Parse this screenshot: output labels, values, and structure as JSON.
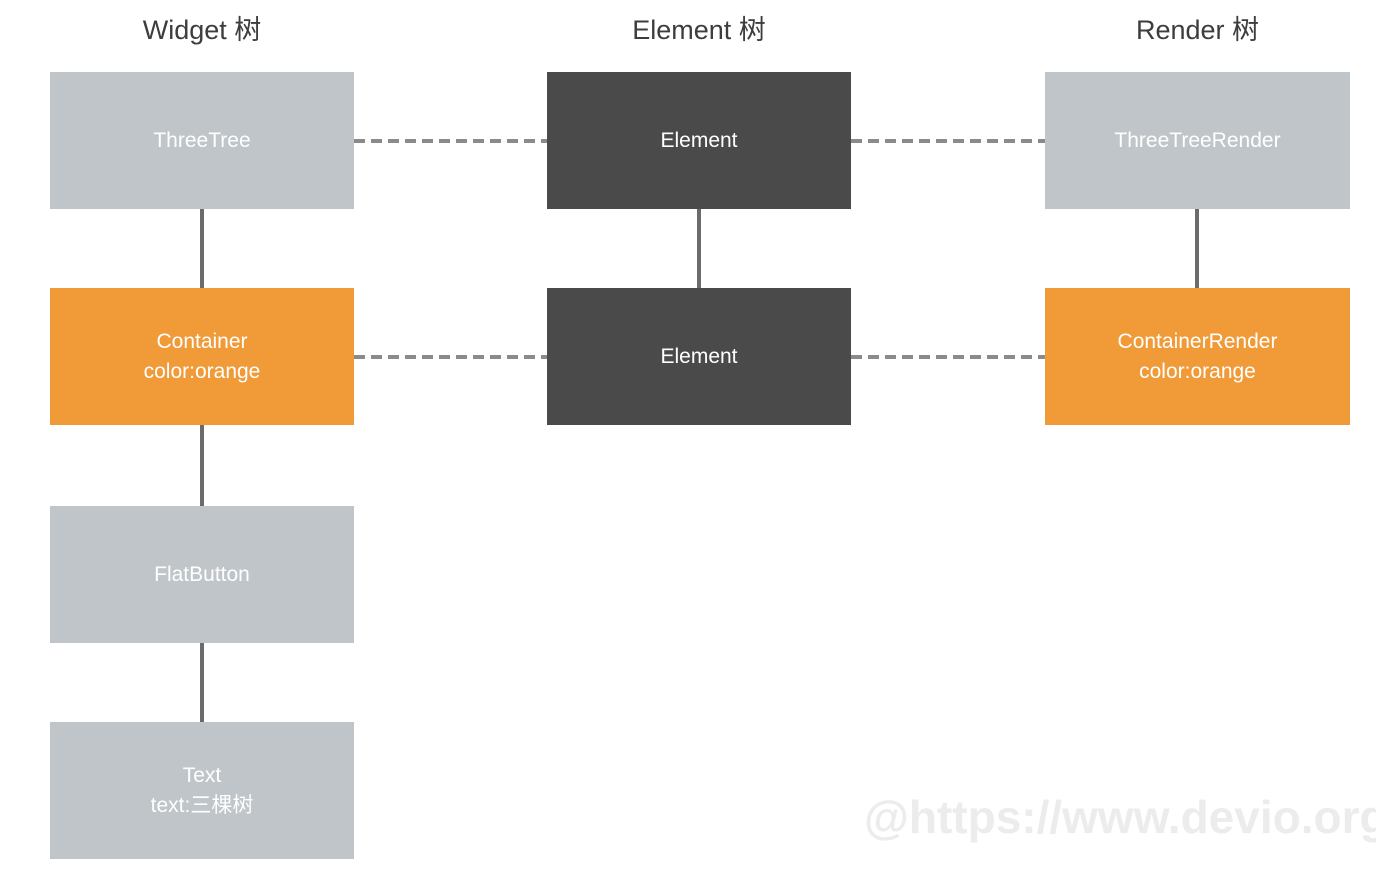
{
  "diagram": {
    "title_row": {
      "widget": "Widget 树",
      "element": "Element 树",
      "render": "Render 树"
    },
    "columns": [
      {
        "key": "widget",
        "header": "Widget 树",
        "nodes": [
          {
            "line1": "ThreeTree",
            "line2": "",
            "color": "#bfc5c9",
            "style": "gray"
          },
          {
            "line1": "Container",
            "line2": "color:orange",
            "color": "#f09a38",
            "style": "orange"
          },
          {
            "line1": "FlatButton",
            "line2": "",
            "color": "#bfc5c9",
            "style": "gray"
          },
          {
            "line1": "Text",
            "line2": "text:三棵树",
            "color": "#bfc5c9",
            "style": "gray"
          }
        ]
      },
      {
        "key": "element",
        "header": "Element 树",
        "nodes": [
          {
            "line1": "Element",
            "line2": "",
            "color": "#4a4a4a",
            "style": "dark"
          },
          {
            "line1": "Element",
            "line2": "",
            "color": "#4a4a4a",
            "style": "dark"
          }
        ]
      },
      {
        "key": "render",
        "header": "Render 树",
        "nodes": [
          {
            "line1": "ThreeTreeRender",
            "line2": "",
            "color": "#bfc5c9",
            "style": "gray"
          },
          {
            "line1": "ContainerRender",
            "line2": "color:orange",
            "color": "#f09a38",
            "style": "orange"
          }
        ]
      }
    ],
    "colors": {
      "gray": "#bfc5c9",
      "orange": "#f09a38",
      "dark": "#4a4a4a",
      "connector": "#6b6b6b",
      "dashed": "#8a8a8a",
      "background": "#ffffff",
      "heading_text": "#3d3d3d",
      "node_text": "#ffffff",
      "watermark": "#ececec"
    },
    "watermark": "@https://www.devio.org"
  }
}
